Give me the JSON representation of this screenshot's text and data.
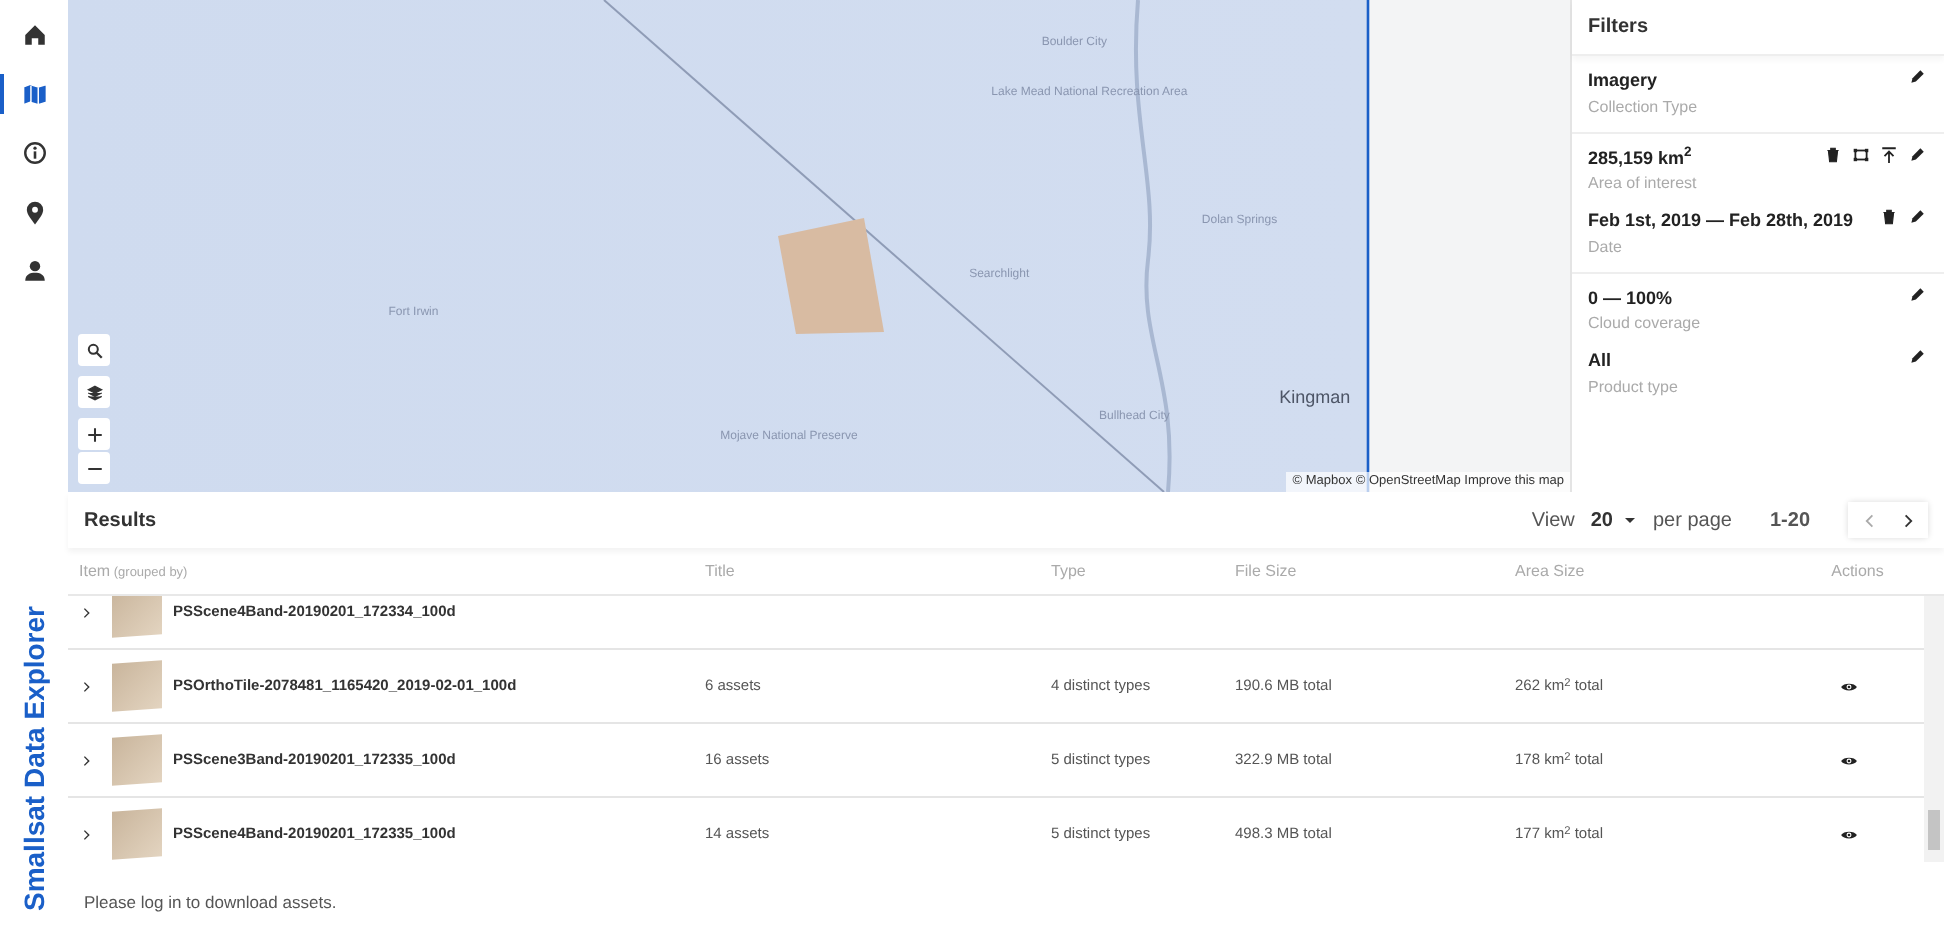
{
  "app_title": "Smallsat Data Explorer",
  "nav": [
    {
      "selected": false
    },
    {
      "selected": true
    },
    {
      "selected": false
    },
    {
      "selected": false
    },
    {
      "selected": false
    }
  ],
  "map": {
    "labels": [
      "Boulder City",
      "Lake Mead National Recreation Area",
      "Fort Irwin",
      "Searchlight",
      "Dolan Springs",
      "Bullhead City",
      "Kingman",
      "Mojave National Preserve"
    ],
    "controls": [
      {
        "kind": "search"
      },
      {
        "kind": "layers"
      }
    ],
    "zoom": [
      {
        "kind": "plus"
      },
      {
        "kind": "minus"
      }
    ],
    "attribution": {
      "mapbox": "© Mapbox",
      "osm": "© OpenStreetMap",
      "improve": "Improve this map"
    }
  },
  "filters": {
    "title": "Filters",
    "groups": [
      [
        {
          "value": "Imagery",
          "label": "Collection Type",
          "kind": "plain"
        }
      ],
      [
        {
          "value": "285,159 km$^{2}$",
          "label": "Area of interest",
          "kind": "area"
        },
        {
          "value": "Feb 1st, 2019 — Feb 28th, 2019",
          "label": "Date",
          "kind": "date"
        }
      ],
      [
        {
          "value": "0 — 100%",
          "label": "Cloud coverage",
          "kind": "plain"
        },
        {
          "value": "All",
          "label": "Product type",
          "kind": "plain"
        }
      ]
    ]
  },
  "results": {
    "title": "Results",
    "view": "View",
    "page_size": "20",
    "per_page": "per page",
    "range": "1-20",
    "columns": [
      {
        "label": "Item",
        "note": "(grouped by)"
      },
      {
        "label": "Title"
      },
      {
        "label": "Type"
      },
      {
        "label": "File Size"
      },
      {
        "label": "Area Size"
      },
      {
        "label": "Actions"
      }
    ],
    "rows": [
      {
        "item": "PSScene4Band-20190201_172334_100d"
      },
      {
        "item": "PSOrthoTile-2078481_1165420_2019-02-01_100d",
        "title": "6 assets",
        "type": "4 distinct types",
        "file_size": "190.6 MB total",
        "area_size": "262 km$^{2}$ total"
      },
      {
        "item": "PSScene3Band-20190201_172335_100d",
        "title": "16 assets",
        "type": "5 distinct types",
        "file_size": "322.9 MB total",
        "area_size": "178 km$^{2}$ total"
      },
      {
        "item": "PSScene4Band-20190201_172335_100d",
        "title": "14 assets",
        "type": "5 distinct types",
        "file_size": "498.3 MB total",
        "area_size": "177 km$^{2}$ total"
      }
    ]
  },
  "footer": {
    "before": "Please",
    "link": "log in",
    "after": "to download assets."
  }
}
